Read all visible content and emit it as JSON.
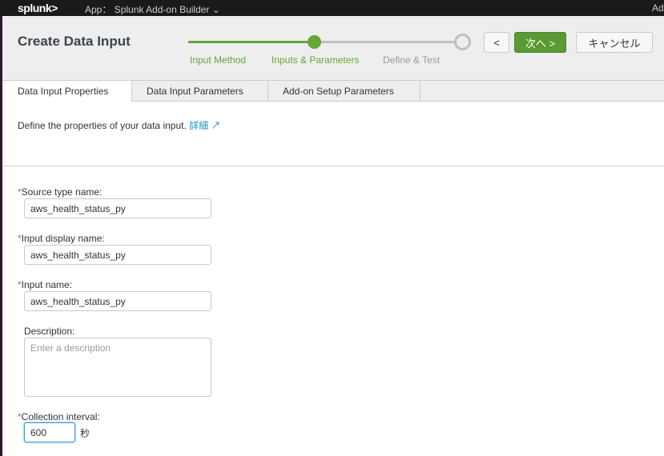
{
  "topbar": {
    "logo": "splunk>",
    "app": "App： Splunk Add-on Builder ⌄",
    "right": "Ad"
  },
  "header": {
    "title": "Create Data Input",
    "steps": [
      {
        "label": "Input Method",
        "state": "done"
      },
      {
        "label": "Inputs & Parameters",
        "state": "active"
      },
      {
        "label": "Define & Test",
        "state": "todo"
      }
    ],
    "back": "<",
    "next": "次へ >",
    "cancel": "キャンセル"
  },
  "colors": {
    "accent": "#65a637",
    "text": "#3c444d",
    "link": "#1e93c6"
  },
  "tabs": [
    "Data Input Properties",
    "Data Input Parameters",
    "Add-on Setup Parameters"
  ],
  "description": {
    "text": "Define the properties of your data input.",
    "link": "詳細",
    "link_icon": "external-link-icon"
  },
  "form": {
    "source_type": {
      "label": "Source type name:",
      "value": "aws_health_status_py"
    },
    "display_name": {
      "label": "Input display name:",
      "value": "aws_health_status_py"
    },
    "input_name": {
      "label": "Input name:",
      "value": "aws_health_status_py"
    },
    "description": {
      "label": "Description:",
      "placeholder": "Enter a description"
    },
    "interval": {
      "label": "Collection interval:",
      "value": "600",
      "unit": "秒"
    }
  }
}
